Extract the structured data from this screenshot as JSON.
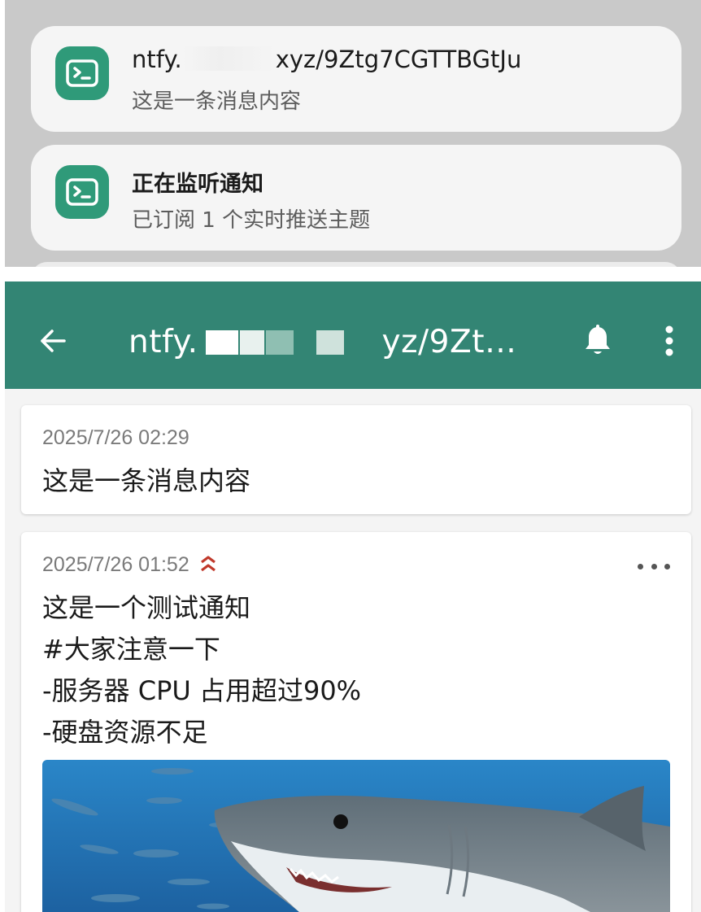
{
  "notifications": [
    {
      "title_start": "ntfy.",
      "title_end": "xyz/9Ztg7CGTTBGtJu",
      "body": "这是一条消息内容",
      "icon": "terminal-icon"
    },
    {
      "title": "正在监听通知",
      "body": "已订阅 1 个实时推送主题",
      "icon": "terminal-icon"
    }
  ],
  "app": {
    "toolbar": {
      "title_start": "ntfy.",
      "title_end": "yz/9Zt…",
      "back_icon": "arrow-left-icon",
      "bell_icon": "bell-icon",
      "menu_icon": "more-vertical-icon"
    },
    "messages": [
      {
        "time": "2025/7/26 02:29",
        "text": "这是一条消息内容"
      },
      {
        "time": "2025/7/26 01:52",
        "priority_icon": "high-priority-icon",
        "text": "这是一个测试通知\n#大家注意一下\n-服务器 CPU 占用超过90%\n-硬盘资源不足",
        "attachment": "shark-image"
      }
    ]
  },
  "colors": {
    "accent": "#338574",
    "icon_bg": "#2f9a79",
    "priority": "#c0392b"
  }
}
